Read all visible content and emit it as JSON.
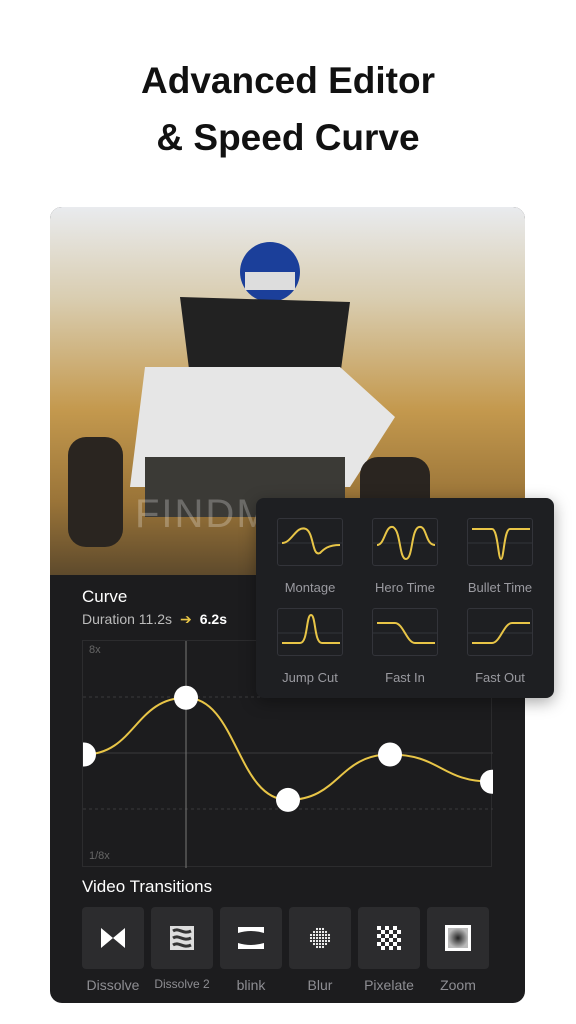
{
  "headline": {
    "line1": "Advanced Editor",
    "line2": "& Speed Curve"
  },
  "watermark": "FINDMEAPK",
  "curve": {
    "title": "Curve",
    "duration_label": "Duration 11.2s",
    "new_duration": "6.2s",
    "y_max_label": "8x",
    "y_min_label": "1/8x",
    "accent": "#e8c547",
    "points": [
      0.5,
      0.75,
      0.3,
      0.5,
      0.38
    ]
  },
  "presets": [
    {
      "label": "Montage"
    },
    {
      "label": "Hero Time"
    },
    {
      "label": "Bullet Time"
    },
    {
      "label": "Jump Cut"
    },
    {
      "label": "Fast In"
    },
    {
      "label": "Fast Out"
    }
  ],
  "transitions": {
    "title": "Video Transitions",
    "items": [
      {
        "label": "Dissolve",
        "icon": "bowtie-icon"
      },
      {
        "label": "Dissolve 2",
        "icon": "dissolve-wave-icon"
      },
      {
        "label": "blink",
        "icon": "blink-icon"
      },
      {
        "label": "Blur",
        "icon": "dot-grid-icon"
      },
      {
        "label": "Pixelate",
        "icon": "checker-icon"
      },
      {
        "label": "Zoom",
        "icon": "zoom-square-icon"
      }
    ]
  }
}
